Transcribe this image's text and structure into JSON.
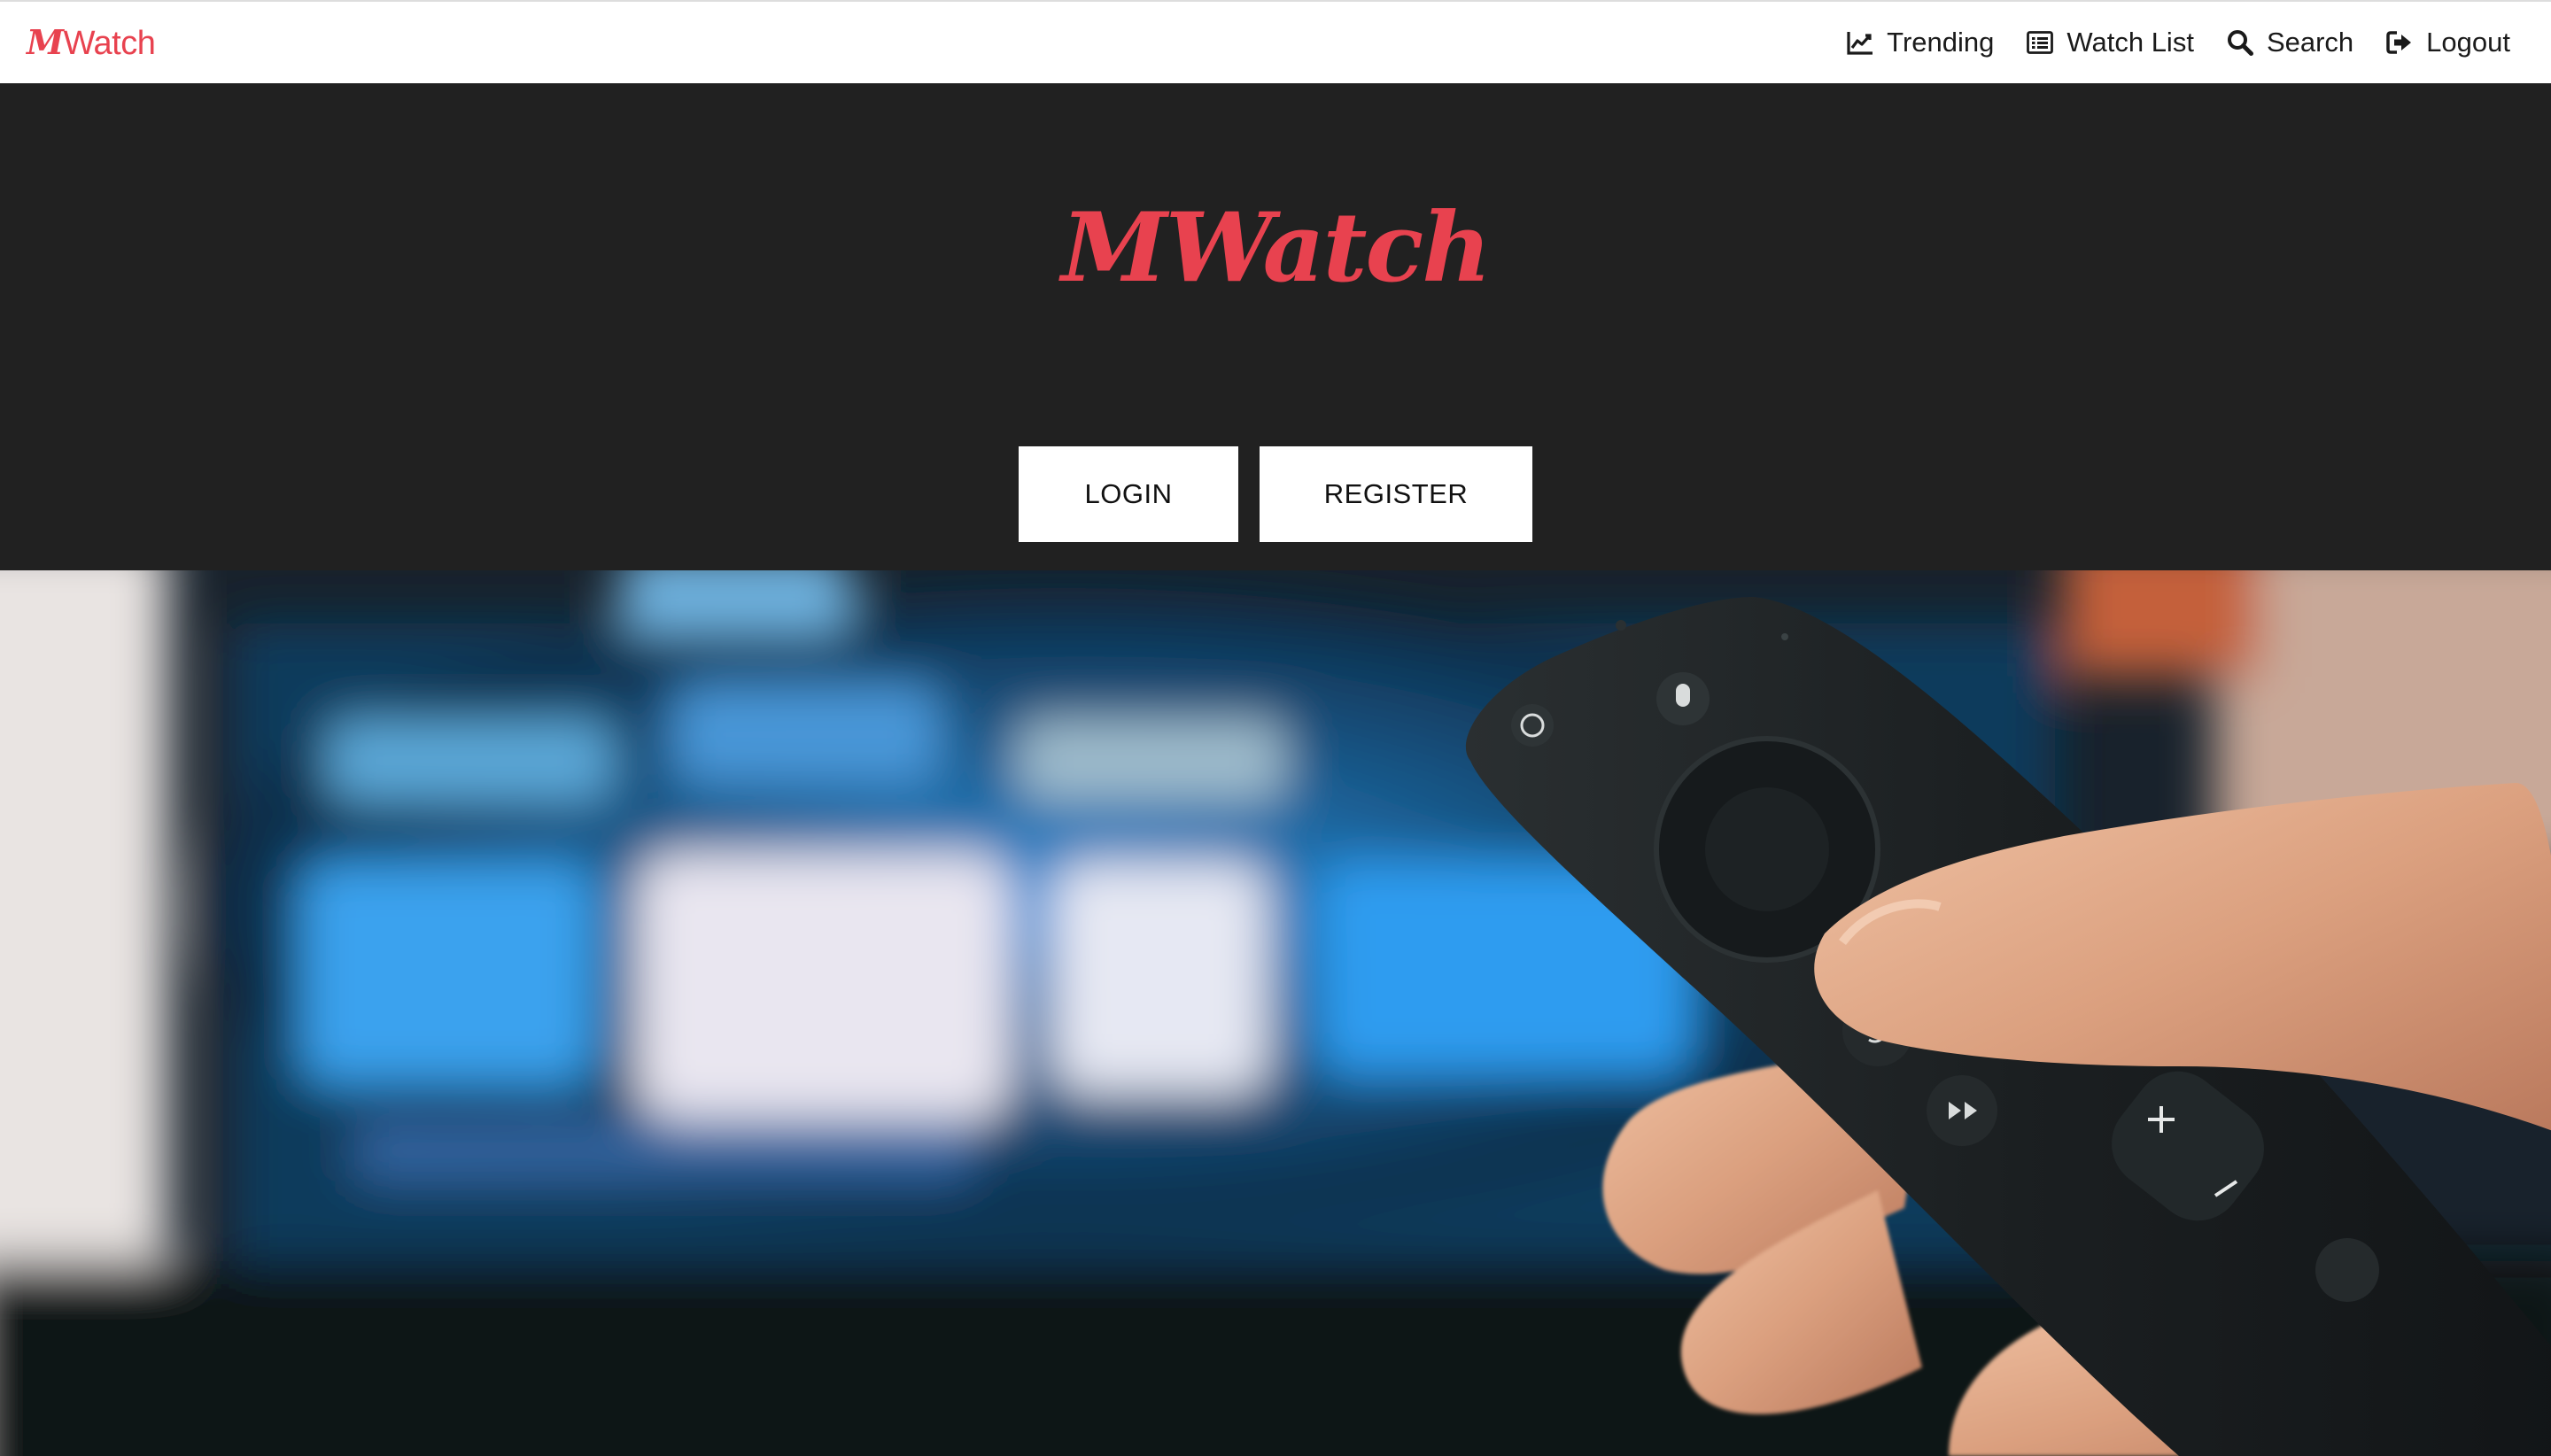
{
  "brand": {
    "initial": "M",
    "rest": "Watch"
  },
  "nav": {
    "items": [
      {
        "label": "Trending",
        "icon": "chart-line-icon"
      },
      {
        "label": "Watch List",
        "icon": "list-alt-icon"
      },
      {
        "label": "Search",
        "icon": "search-icon"
      },
      {
        "label": "Logout",
        "icon": "sign-out-icon"
      }
    ]
  },
  "hero": {
    "logo": "MWatch",
    "login_label": "LOGIN",
    "register_label": "REGISTER"
  },
  "background_image": {
    "icon": "tv-remote-photo"
  },
  "colors": {
    "brand": "#e8424f",
    "hero_bg": "#212121",
    "nav_bg": "#ffffff",
    "button_bg": "#ffffff"
  }
}
